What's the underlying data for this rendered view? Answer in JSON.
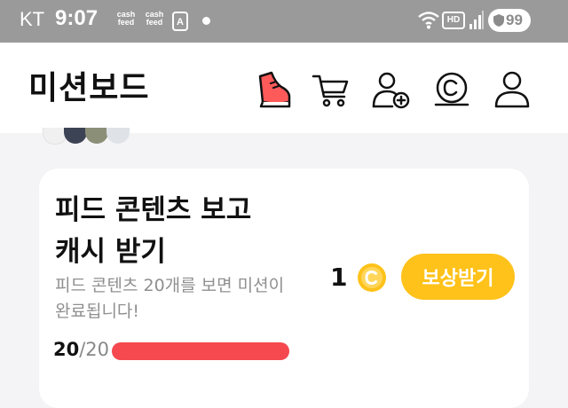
{
  "status_bar": {
    "carrier": "KT",
    "time": "9:07",
    "cashfeed_icon_1": {
      "line1": "cash",
      "line2": "feed"
    },
    "cashfeed_icon_2": {
      "line1": "cash",
      "line2": "feed"
    },
    "hd_label": "HD",
    "battery_level": "99"
  },
  "header": {
    "title": "미션보드",
    "icons": [
      "shoe-icon",
      "shopping-cart-icon",
      "add-friend-icon",
      "coin-history-icon",
      "profile-icon"
    ]
  },
  "mission_card": {
    "title_line1": "피드 콘텐츠 보고",
    "title_line2": "캐시 받기",
    "desc_line1": "피드 콘텐츠 20개를 보면 미션이",
    "desc_line2": "완료됩니다!",
    "progress_current": "20",
    "progress_total": "/20",
    "progress_fraction": 1.0,
    "reward_amount": "1",
    "reward_icon": "coin-icon",
    "reward_button_label": "보상받기"
  },
  "colors": {
    "status_bar_bg": "#9a9a9a",
    "accent_yellow": "#ffc21a",
    "progress_red": "#f5484f",
    "page_bg": "#f4f4f6"
  }
}
